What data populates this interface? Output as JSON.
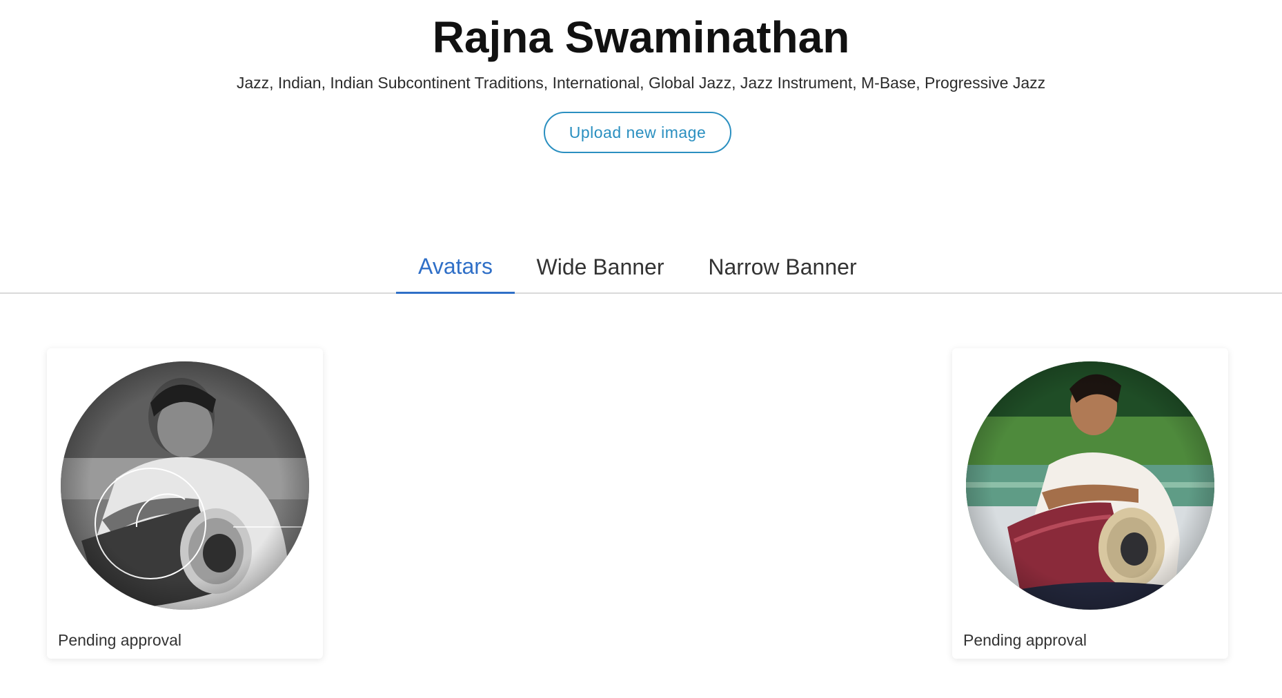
{
  "header": {
    "artist_name": "Rajna Swaminathan",
    "genres": "Jazz, Indian, Indian Subcontinent Traditions, International, Global Jazz, Jazz Instrument, M-Base, Progressive Jazz",
    "upload_label": "Upload new image"
  },
  "tabs": [
    {
      "label": "Avatars",
      "active": true
    },
    {
      "label": "Wide Banner",
      "active": false
    },
    {
      "label": "Narrow Banner",
      "active": false
    }
  ],
  "colors": {
    "accent": "#2f6fc7",
    "upload_button": "#2a8fc0",
    "tab_divider": "#d9d9d9"
  },
  "avatars": [
    {
      "style": "black-and-white",
      "status": "Pending approval"
    },
    {
      "style": "color",
      "status": "Pending approval"
    }
  ]
}
